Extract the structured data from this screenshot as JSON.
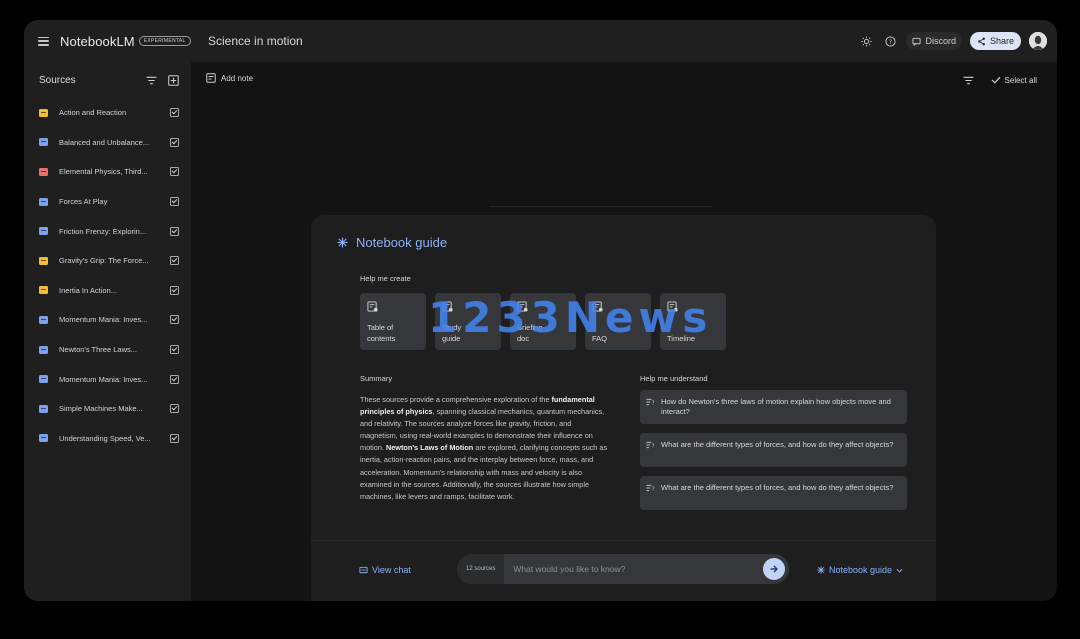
{
  "header": {
    "app_name": "NotebookLM",
    "badge": "EXPERIMENTAL",
    "notebook_title": "Science in motion",
    "discord_label": "Discord",
    "share_label": "Share"
  },
  "sidebar": {
    "title": "Sources",
    "items": [
      {
        "label": "Action and Reaction",
        "icon": "slides-icon",
        "color": "#f5bd36"
      },
      {
        "label": "Balanced and Unbalance...",
        "icon": "doc-icon",
        "color": "#7ba1f0"
      },
      {
        "label": "Elemental Physics, Third...",
        "icon": "pdf-icon",
        "color": "#e8706a"
      },
      {
        "label": "Forces At Play",
        "icon": "doc-icon",
        "color": "#7ba1f0"
      },
      {
        "label": "Friction Frenzy: Explorin...",
        "icon": "doc-icon",
        "color": "#7ba1f0"
      },
      {
        "label": "Gravity's Grip: The Force...",
        "icon": "slides-icon",
        "color": "#f5bd36"
      },
      {
        "label": "Inertia In Action...",
        "icon": "slides-icon",
        "color": "#f5bd36"
      },
      {
        "label": "Momentum Mania: Inves...",
        "icon": "doc-icon",
        "color": "#7ba1f0"
      },
      {
        "label": "Newton's Three Laws...",
        "icon": "doc-icon",
        "color": "#7ba1f0"
      },
      {
        "label": "Momentum Mania: Inves...",
        "icon": "doc-icon",
        "color": "#7ba1f0"
      },
      {
        "label": "Simple Machines Make...",
        "icon": "doc-icon",
        "color": "#7ba1f0"
      },
      {
        "label": "Understanding Speed, Ve...",
        "icon": "doc-icon",
        "color": "#7ba1f0"
      }
    ]
  },
  "toolbar": {
    "add_note": "Add note",
    "select_all": "Select all"
  },
  "guide": {
    "title": "Notebook guide",
    "help_create": "Help me create",
    "cards": [
      {
        "line1": "Table of",
        "line2": "contents"
      },
      {
        "line1": "Study",
        "line2": "guide"
      },
      {
        "line1": "Briefing",
        "line2": "doc"
      },
      {
        "line1": "",
        "line2": "FAQ"
      },
      {
        "line1": "",
        "line2": "Timeline"
      }
    ],
    "summary_title": "Summary",
    "summary_parts": {
      "p1": "These sources provide a comprehensive exploration of the ",
      "b1": "fundamental principles of physics",
      "p2": ", spanning classical mechanics, quantum mechanics, and relativity. The sources analyze forces like gravity, friction, and magnetism, using real-world examples to demonstrate their influence on motion. ",
      "b2": "Newton's Laws of Motion",
      "p3": " are explored, clarifying concepts such as inertia, action-reaction pairs, and the interplay between force, mass, and acceleration. Momentum's relationship with mass and velocity is also examined in the sources. Additionally, the sources illustrate how simple machines, like levers and ramps, facilitate work."
    },
    "understand_title": "Help me understand",
    "questions": [
      "How do Newton's three laws of motion explain how objects move and interact?",
      "What are the different types of forces, and how do they affect objects?",
      "What are the different types of forces, and how do they affect objects?"
    ]
  },
  "chat": {
    "view_chat": "View chat",
    "source_count": "12 sources",
    "placeholder": "What would you like to know?",
    "guide_toggle": "Notebook guide"
  },
  "watermark": "1233News"
}
